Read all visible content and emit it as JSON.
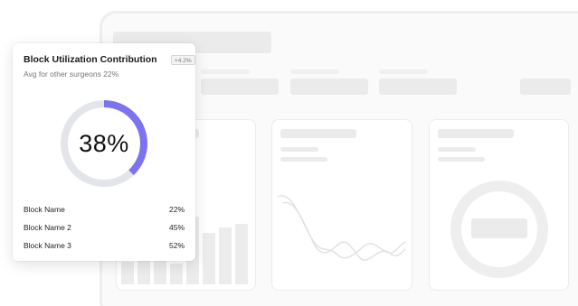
{
  "card": {
    "title": "Block Utilization Contribution",
    "delta_badge": "+4.2%",
    "subtitle": "Avg for other surgeons 22%",
    "value_label": "38%",
    "value_fraction": 0.38,
    "accent_color": "#7b74ee",
    "track_color": "#e4e5ea",
    "rows": [
      {
        "name": "Block Name",
        "value": "22%"
      },
      {
        "name": "Block Name 2",
        "value": "45%"
      },
      {
        "name": "Block Name 3",
        "value": "52%"
      }
    ]
  }
}
